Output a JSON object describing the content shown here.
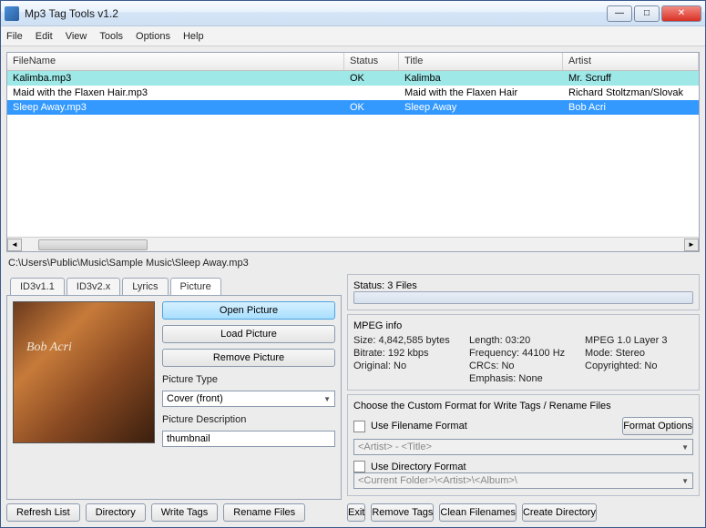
{
  "window": {
    "title": "Mp3 Tag Tools v1.2"
  },
  "menu": [
    "File",
    "Edit",
    "View",
    "Tools",
    "Options",
    "Help"
  ],
  "columns": {
    "file": "FileName",
    "status": "Status",
    "title": "Title",
    "artist": "Artist"
  },
  "rows": [
    {
      "file": "Kalimba.mp3",
      "status": "OK",
      "title": "Kalimba",
      "artist": "Mr. Scruff"
    },
    {
      "file": "Maid with the Flaxen Hair.mp3",
      "status": "",
      "title": "Maid with the Flaxen Hair",
      "artist": "Richard Stoltzman/Slovak"
    },
    {
      "file": "Sleep Away.mp3",
      "status": "OK",
      "title": "Sleep Away",
      "artist": "Bob Acri"
    }
  ],
  "path": "C:\\Users\\Public\\Music\\Sample Music\\Sleep Away.mp3",
  "tabs": [
    "ID3v1.1",
    "ID3v2.x",
    "Lyrics",
    "Picture"
  ],
  "picture": {
    "open": "Open Picture",
    "load": "Load Picture",
    "remove": "Remove Picture",
    "typeLabel": "Picture Type",
    "typeValue": "Cover (front)",
    "descLabel": "Picture Description",
    "descValue": "thumbnail",
    "albumText": "Bob Acri"
  },
  "status": {
    "label": "Status: 3 Files"
  },
  "mpeg": {
    "header": "MPEG info",
    "size": "Size: 4,842,585 bytes",
    "bitrate": "Bitrate: 192 kbps",
    "original": "Original: No",
    "length": "Length:  03:20",
    "freq": "Frequency: 44100 Hz",
    "crc": "CRCs: No",
    "layer": "MPEG 1.0 Layer 3",
    "mode": "Mode: Stereo",
    "emphasis": "Emphasis: None",
    "copyright": "Copyrighted: No"
  },
  "format": {
    "choose": "Choose the Custom Format for Write Tags / Rename Files",
    "useFile": "Use Filename Format",
    "fileCombo": "<Artist> - <Title>",
    "useDir": "Use Directory Format",
    "dirCombo": "<Current Folder>\\<Artist>\\<Album>\\",
    "options": "Format Options"
  },
  "buttons": {
    "refresh": "Refresh List",
    "directory": "Directory",
    "writeTags": "Write Tags",
    "renameFiles": "Rename Files",
    "exit": "Exit",
    "removeTags": "Remove Tags",
    "cleanFilenames": "Clean Filenames",
    "createDirectory": "Create Directory"
  }
}
